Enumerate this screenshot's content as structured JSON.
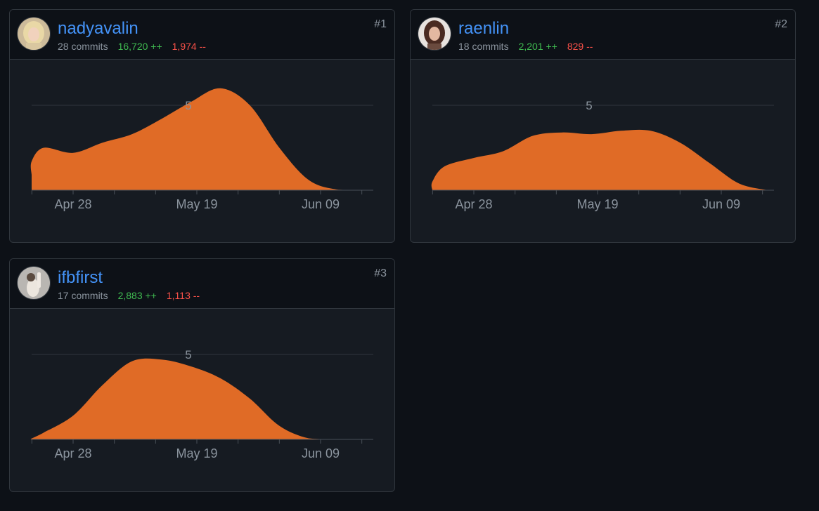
{
  "contributors": [
    {
      "rank": "#1",
      "username": "nadyavalin",
      "commits": "28 commits",
      "additions": "16,720 ++",
      "deletions": "1,974 --",
      "avatar": "blonde-woman-photo"
    },
    {
      "rank": "#2",
      "username": "raenlin",
      "commits": "18 commits",
      "additions": "2,201 ++",
      "deletions": "829 --",
      "avatar": "dark-haired-woman-photo"
    },
    {
      "rank": "#3",
      "username": "ifbfirst",
      "commits": "17 commits",
      "additions": "2,883 ++",
      "deletions": "1,113 --",
      "avatar": "cat-photo"
    }
  ],
  "colors": {
    "area": "#e06b26",
    "link": "#4493f8",
    "additions": "#3fb950",
    "deletions": "#f85149"
  },
  "chart_data": [
    {
      "type": "area",
      "x_tick_labels": [
        "Apr 28",
        "May 19",
        "Jun 09"
      ],
      "y_tick_labels": [
        "5"
      ],
      "ylim": [
        0,
        6
      ],
      "x": [
        -14,
        -10,
        -5,
        0,
        5,
        10,
        15,
        20,
        25,
        30,
        35,
        40,
        45,
        50,
        55
      ],
      "values": [
        0.9,
        1.7,
        2.5,
        2.2,
        2.8,
        3.3,
        4.2,
        5.2,
        6.0,
        5.0,
        2.5,
        0.6,
        0.03,
        0,
        0
      ]
    },
    {
      "type": "area",
      "x_tick_labels": [
        "Apr 28",
        "May 19",
        "Jun 09"
      ],
      "y_tick_labels": [
        "5"
      ],
      "ylim": [
        0,
        6
      ],
      "x": [
        -14,
        -10,
        -5,
        0,
        5,
        10,
        15,
        20,
        25,
        30,
        35,
        40,
        45,
        50,
        55
      ],
      "values": [
        0,
        0.5,
        1.4,
        1.9,
        2.3,
        3.2,
        3.4,
        3.3,
        3.5,
        3.5,
        2.8,
        1.6,
        0.4,
        0,
        0
      ]
    },
    {
      "type": "area",
      "x_tick_labels": [
        "Apr 28",
        "May 19",
        "Jun 09"
      ],
      "y_tick_labels": [
        "5"
      ],
      "ylim": [
        0,
        6
      ],
      "x": [
        -14,
        -10,
        -5,
        0,
        5,
        10,
        15,
        20,
        25,
        30,
        35,
        40,
        45,
        50,
        55
      ],
      "values": [
        0,
        0.05,
        0.4,
        1.4,
        3.2,
        4.6,
        4.7,
        4.3,
        3.6,
        2.4,
        0.8,
        0.06,
        0,
        0,
        0
      ]
    }
  ]
}
